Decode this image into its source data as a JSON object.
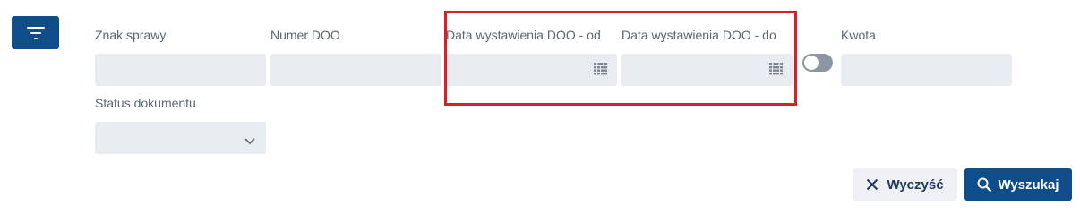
{
  "filters": {
    "toggle_icon": "filter-icon",
    "fields": {
      "znak_sprawy": {
        "label": "Znak sprawy",
        "value": ""
      },
      "numer_doo": {
        "label": "Numer DOO",
        "value": ""
      },
      "data_od": {
        "label": "Data wystawienia DOO - od",
        "value": "",
        "icon": "calendar-icon"
      },
      "data_do": {
        "label": "Data wystawienia DOO - do",
        "value": "",
        "icon": "calendar-icon"
      },
      "kwota": {
        "label": "Kwota",
        "value": ""
      },
      "status": {
        "label": "Status dokumentu",
        "selected": "",
        "icon": "chevron-down-icon"
      }
    },
    "range_toggle": {
      "on": false
    }
  },
  "actions": {
    "clear_label": "Wyczyść",
    "search_label": "Wyszukaj"
  },
  "colors": {
    "primary": "#0f4c8a",
    "input_bg": "#e8ebf0",
    "highlight": "#d81f2a",
    "label": "#5a6673"
  }
}
